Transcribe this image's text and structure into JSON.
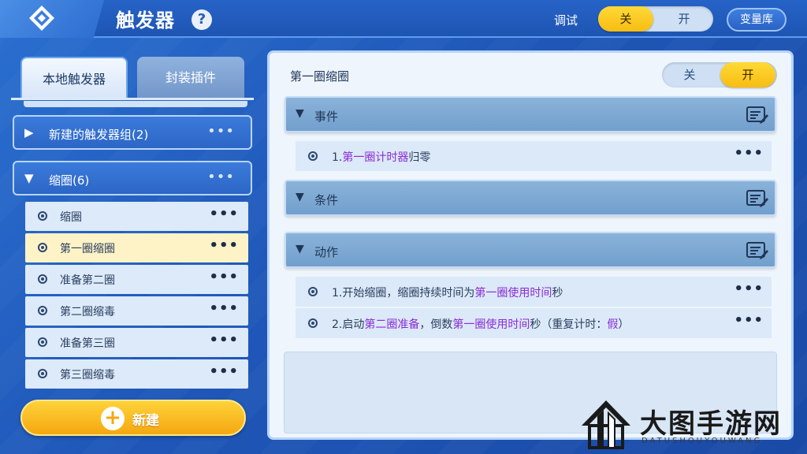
{
  "header": {
    "title": "触发器",
    "help_icon": "?",
    "debug_label": "调试",
    "debug_toggle": {
      "off": "关",
      "on": "开",
      "selected": "关"
    },
    "var_lib_button": "变量库"
  },
  "left": {
    "tabs": [
      {
        "label": "本地触发器",
        "active": true
      },
      {
        "label": "封装插件",
        "active": false
      }
    ],
    "groups": [
      {
        "label": "新建的触发器组(2)",
        "expanded": false
      },
      {
        "label": "缩圈(6)",
        "expanded": true
      }
    ],
    "items": [
      {
        "label": "缩圈",
        "selected": false
      },
      {
        "label": "第一圈缩圈",
        "selected": true
      },
      {
        "label": "准备第二圈",
        "selected": false
      },
      {
        "label": "第二圈缩毒",
        "selected": false
      },
      {
        "label": "准备第三圈",
        "selected": false
      },
      {
        "label": "第三圈缩毒",
        "selected": false
      }
    ],
    "new_button": "新建",
    "more": "•••"
  },
  "right": {
    "title": "第一圈缩圈",
    "toggle": {
      "off": "关",
      "on": "开",
      "selected": "开"
    },
    "sections": {
      "event": "事件",
      "condition": "条件",
      "action": "动作"
    },
    "event_rows": [
      {
        "parts": [
          {
            "t": "1.",
            "hl": false
          },
          {
            "t": "第一圈计时器",
            "hl": true
          },
          {
            "t": "归零",
            "hl": false
          }
        ]
      }
    ],
    "action_rows": [
      {
        "parts": [
          {
            "t": "1.开始缩圈，缩圈持续时间为",
            "hl": false
          },
          {
            "t": "第一圈使用时间",
            "hl": true
          },
          {
            "t": "秒",
            "hl": false
          }
        ]
      },
      {
        "parts": [
          {
            "t": "2.启动",
            "hl": false
          },
          {
            "t": "第二圈准备",
            "hl": true
          },
          {
            "t": "，倒数",
            "hl": false
          },
          {
            "t": "第一圈使用时间",
            "hl": true
          },
          {
            "t": "秒（重复计时：",
            "hl": false
          },
          {
            "t": "假",
            "hl": true
          },
          {
            "t": "）",
            "hl": false
          }
        ]
      }
    ],
    "more": "•••"
  },
  "watermark": {
    "text": "大图手游网",
    "sub": "DATUSHOUYOUWANG"
  },
  "colors": {
    "accent_yellow": "#f7bd12",
    "highlight_purple": "#8a2bd6",
    "header_blue": "#2663c7"
  }
}
